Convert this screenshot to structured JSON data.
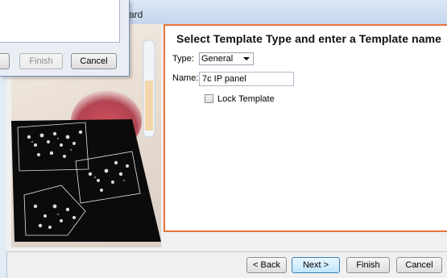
{
  "window": {
    "title_fragment": "ard"
  },
  "template_panel": {
    "heading": "Select Template Type and enter a Template name",
    "type_label": "Type:",
    "type_value": "General",
    "name_label": "Name:",
    "name_value": "7c IP panel",
    "lock_label": "Lock Template",
    "lock_checked": false
  },
  "buttons": {
    "back": "< Back",
    "next": "Next >",
    "finish": "Finish",
    "cancel": "Cancel"
  },
  "dialog": {
    "finish": "Finish",
    "cancel": "Cancel"
  },
  "colors": {
    "panel_border": "#e8743b",
    "primary_button": "#bee6fd"
  }
}
